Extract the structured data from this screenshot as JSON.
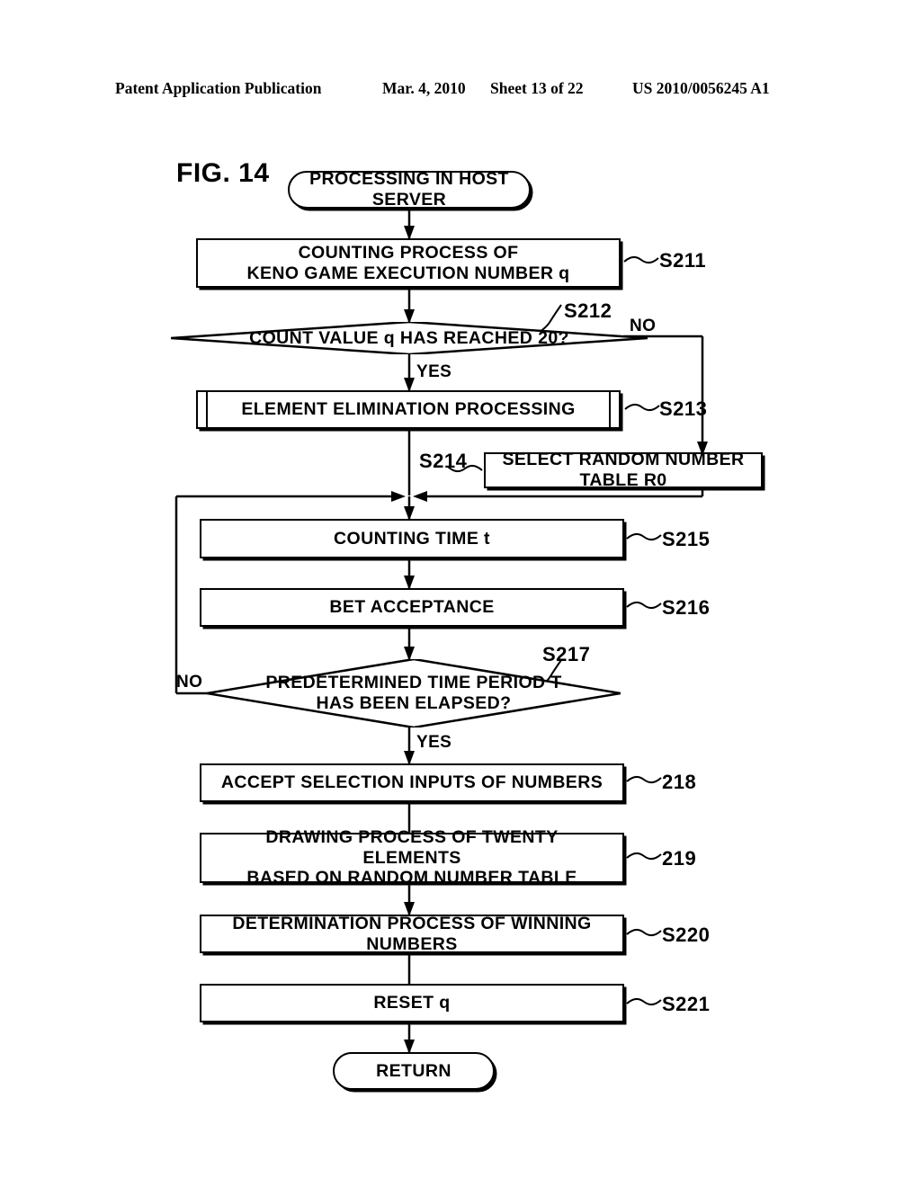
{
  "header": {
    "publication": "Patent Application Publication",
    "date": "Mar. 4, 2010",
    "sheet": "Sheet 13 of 22",
    "patent_number": "US 2010/0056245 A1"
  },
  "figure": {
    "label": "FIG. 14"
  },
  "flowchart": {
    "start": {
      "text": "PROCESSING IN HOST SERVER"
    },
    "end": {
      "text": "RETURN"
    },
    "nodes": [
      {
        "id": "s211",
        "type": "process",
        "text_line1": "COUNTING PROCESS OF",
        "text_line2": "KENO GAME EXECUTION NUMBER q",
        "step": "S211"
      },
      {
        "id": "s212",
        "type": "decision",
        "text_line1": "COUNT VALUE q HAS REACHED 20?",
        "text_line2": "",
        "step": "S212",
        "yes_label": "YES",
        "no_label": "NO"
      },
      {
        "id": "s213",
        "type": "subroutine",
        "text_line1": "ELEMENT ELIMINATION PROCESSING",
        "text_line2": "",
        "step": "S213"
      },
      {
        "id": "s214",
        "type": "process",
        "text_line1": "SELECT RANDOM NUMBER TABLE R0",
        "text_line2": "",
        "step": "S214"
      },
      {
        "id": "s215",
        "type": "process",
        "text_line1": "COUNTING TIME t",
        "text_line2": "",
        "step": "S215"
      },
      {
        "id": "s216",
        "type": "process",
        "text_line1": "BET ACCEPTANCE",
        "text_line2": "",
        "step": "S216"
      },
      {
        "id": "s217",
        "type": "decision",
        "text_line1": "PREDETERMINED TIME PERIOD T",
        "text_line2": "HAS BEEN ELAPSED?",
        "step": "S217",
        "yes_label": "YES",
        "no_label": "NO"
      },
      {
        "id": "s218",
        "type": "process",
        "text_line1": "ACCEPT SELECTION INPUTS OF NUMBERS",
        "text_line2": "",
        "step": "218"
      },
      {
        "id": "s219",
        "type": "process",
        "text_line1": "DRAWING PROCESS OF TWENTY ELEMENTS",
        "text_line2": "BASED ON RANDOM NUMBER TABLE",
        "step": "219"
      },
      {
        "id": "s220",
        "type": "process",
        "text_line1": "DETERMINATION PROCESS OF WINNING NUMBERS",
        "text_line2": "",
        "step": "S220"
      },
      {
        "id": "s221",
        "type": "process",
        "text_line1": "RESET q",
        "text_line2": "",
        "step": "S221"
      }
    ]
  },
  "colors": {
    "ink": "#000000",
    "paper": "#ffffff"
  }
}
